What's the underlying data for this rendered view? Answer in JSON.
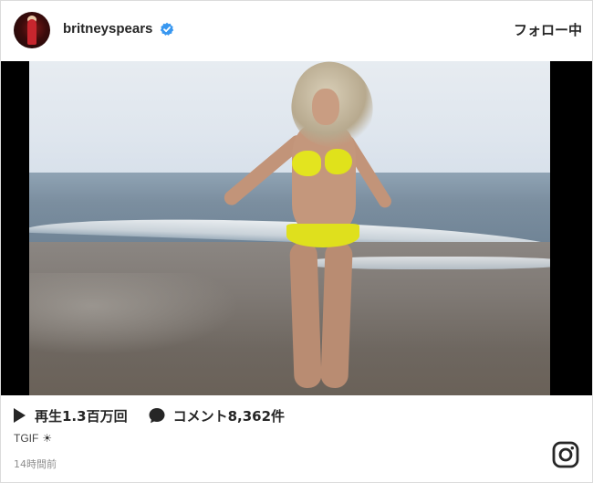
{
  "header": {
    "username": "britneyspears",
    "follow_label": "フォロー中",
    "avatar_icon": "profile-avatar",
    "verified_icon": "verified-badge-icon",
    "verified_color": "#3897f0"
  },
  "media": {
    "type": "video",
    "description_icon": "video-player"
  },
  "stats": {
    "views_label": "再生1.3百万回",
    "comments_label": "コメント8,362件",
    "play_icon": "play-icon",
    "comment_icon": "comment-bubble-icon"
  },
  "caption": {
    "text": "TGIF",
    "emoji_icon": "sun-icon"
  },
  "timestamp": "14時間前",
  "brand_icon": "instagram-logo-icon"
}
